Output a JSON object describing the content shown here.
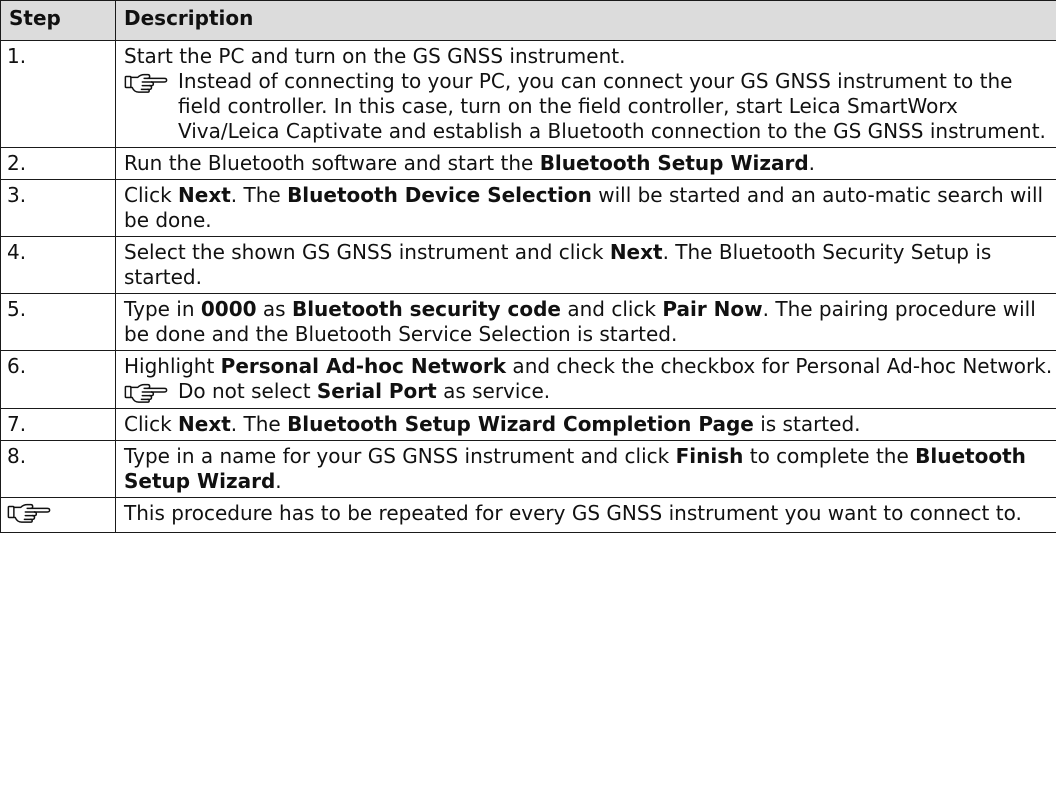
{
  "table": {
    "headers": [
      "Step",
      "Description"
    ],
    "rows": [
      {
        "step": "1.",
        "text_parts": [
          {
            "t": "Start the PC and turn on the GS GNSS instrument.",
            "b": false
          }
        ],
        "note": "Instead of connecting to your PC, you can connect your GS GNSS instrument to the field controller. In this case, turn on the field controller, start Leica SmartWorx Viva/Leica Captivate and establish a Bluetooth connection to the GS GNSS instrument."
      },
      {
        "step": "2.",
        "text_parts": [
          {
            "t": "Run the Bluetooth software and start the ",
            "b": false
          },
          {
            "t": "Bluetooth Setup Wizard",
            "b": true
          },
          {
            "t": ".",
            "b": false
          }
        ]
      },
      {
        "step": "3.",
        "text_parts": [
          {
            "t": "Click ",
            "b": false
          },
          {
            "t": "Next",
            "b": true
          },
          {
            "t": ". The ",
            "b": false
          },
          {
            "t": "Bluetooth Device Selection",
            "b": true
          },
          {
            "t": " will be started and an auto-matic search will be done.",
            "b": false
          }
        ]
      },
      {
        "step": "4.",
        "text_parts": [
          {
            "t": "Select the shown GS GNSS instrument and click ",
            "b": false
          },
          {
            "t": "Next",
            "b": true
          },
          {
            "t": ". The Bluetooth Security Setup is started.",
            "b": false
          }
        ]
      },
      {
        "step": "5.",
        "text_parts": [
          {
            "t": "Type in ",
            "b": false
          },
          {
            "t": "0000",
            "b": true
          },
          {
            "t": " as ",
            "b": false
          },
          {
            "t": "Bluetooth security code",
            "b": true
          },
          {
            "t": " and click ",
            "b": false
          },
          {
            "t": "Pair Now",
            "b": true
          },
          {
            "t": ". The pairing procedure will be done and the Bluetooth Service Selection is started.",
            "b": false
          }
        ]
      },
      {
        "step": "6.",
        "text_parts": [
          {
            "t": "Highlight ",
            "b": false
          },
          {
            "t": "Personal Ad-hoc Network",
            "b": true
          },
          {
            "t": " and check the checkbox for Personal Ad-hoc Network.",
            "b": false
          }
        ],
        "note_parts": [
          {
            "t": "Do not select ",
            "b": false
          },
          {
            "t": "Serial Port",
            "b": true
          },
          {
            "t": " as service.",
            "b": false
          }
        ]
      },
      {
        "step": "7.",
        "text_parts": [
          {
            "t": "Click ",
            "b": false
          },
          {
            "t": "Next",
            "b": true
          },
          {
            "t": ". The ",
            "b": false
          },
          {
            "t": "Bluetooth Setup Wizard Completion Page",
            "b": true
          },
          {
            "t": " is started.",
            "b": false
          }
        ]
      },
      {
        "step": "8.",
        "text_parts": [
          {
            "t": "Type in a name for your GS GNSS instrument and click ",
            "b": false
          },
          {
            "t": "Finish",
            "b": true
          },
          {
            "t": " to complete the ",
            "b": false
          },
          {
            "t": "Bluetooth Setup Wizard",
            "b": true
          },
          {
            "t": ".",
            "b": false
          }
        ]
      },
      {
        "step_icon": "pointing-hand-icon",
        "text_parts": [
          {
            "t": "This procedure has to be repeated for every GS GNSS instrument you want to connect to.",
            "b": false
          }
        ]
      }
    ]
  },
  "colors": {
    "header_bg": "#dcdcdc",
    "border": "#1a1a1a",
    "text": "#111111"
  }
}
